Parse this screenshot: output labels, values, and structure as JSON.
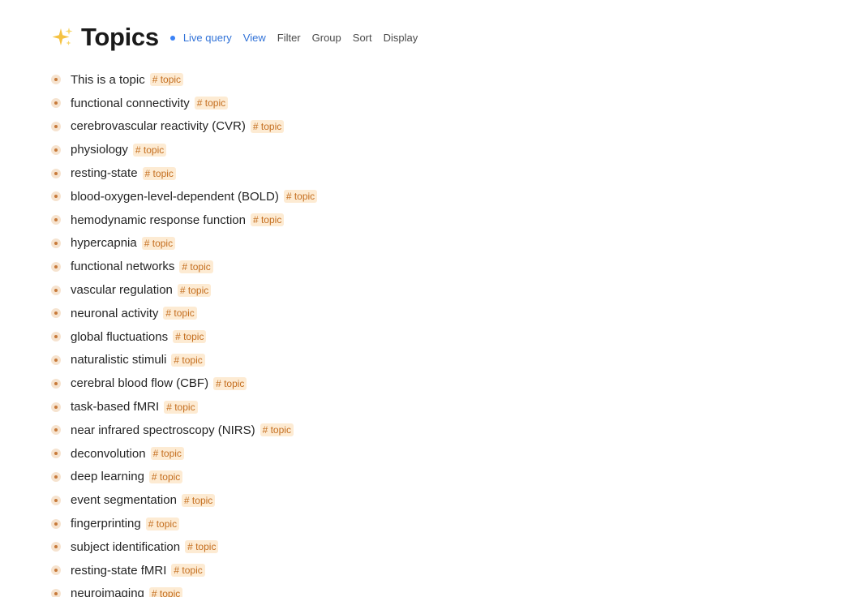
{
  "header": {
    "title": "Topics",
    "icon": "sparkles-icon",
    "live_query_label": "Live query",
    "view_label": "View",
    "filter_label": "Filter",
    "group_label": "Group",
    "sort_label": "Sort",
    "display_label": "Display",
    "accent_color": "#3273d8",
    "tag_color": "#c46e1f"
  },
  "topics": [
    {
      "label": "This is a topic",
      "tag": "# topic"
    },
    {
      "label": "functional connectivity",
      "tag": "# topic"
    },
    {
      "label": "cerebrovascular reactivity (CVR)",
      "tag": "# topic"
    },
    {
      "label": "physiology",
      "tag": "# topic"
    },
    {
      "label": "resting-state",
      "tag": "# topic"
    },
    {
      "label": "blood-oxygen-level-dependent (BOLD)",
      "tag": "# topic"
    },
    {
      "label": "hemodynamic response function",
      "tag": "# topic"
    },
    {
      "label": "hypercapnia",
      "tag": "# topic"
    },
    {
      "label": "functional networks",
      "tag": "# topic"
    },
    {
      "label": "vascular regulation",
      "tag": "# topic"
    },
    {
      "label": "neuronal activity",
      "tag": "# topic"
    },
    {
      "label": "global fluctuations",
      "tag": "# topic"
    },
    {
      "label": "naturalistic stimuli",
      "tag": "# topic"
    },
    {
      "label": "cerebral blood flow (CBF)",
      "tag": "# topic"
    },
    {
      "label": "task-based fMRI",
      "tag": "# topic"
    },
    {
      "label": "near infrared spectroscopy (NIRS)",
      "tag": "# topic"
    },
    {
      "label": "deconvolution",
      "tag": "# topic"
    },
    {
      "label": "deep learning",
      "tag": "# topic"
    },
    {
      "label": "event segmentation",
      "tag": "# topic"
    },
    {
      "label": "fingerprinting",
      "tag": "# topic"
    },
    {
      "label": "subject identification",
      "tag": "# topic"
    },
    {
      "label": "resting-state fMRI",
      "tag": "# topic"
    },
    {
      "label": "neuroimaging",
      "tag": "# topic"
    }
  ]
}
